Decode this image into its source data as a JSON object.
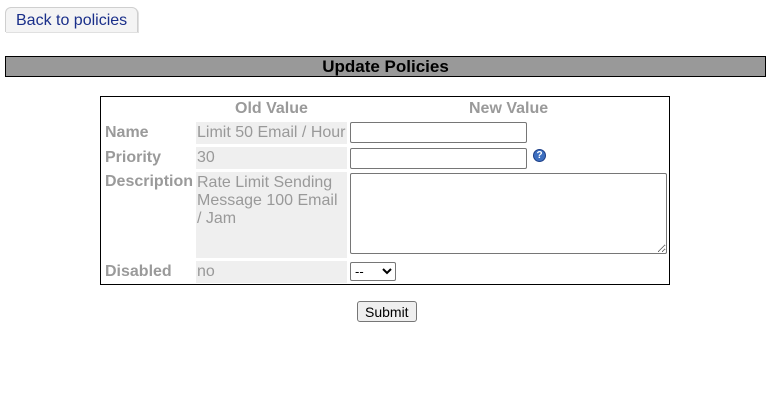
{
  "nav": {
    "back_label": "Back to policies"
  },
  "page": {
    "title": "Update Policies"
  },
  "table": {
    "col_old": "Old Value",
    "col_new": "New Value",
    "rows": [
      {
        "label": "Name",
        "old": "Limit 50 Email / Hour",
        "new_value": ""
      },
      {
        "label": "Priority",
        "old": "30",
        "new_value": ""
      },
      {
        "label": "Description",
        "old": "Rate Limit Sending Message 100 Email / Jam",
        "new_value": ""
      },
      {
        "label": "Disabled",
        "old": "no",
        "new_value": "--"
      }
    ]
  },
  "disabled_options": [
    "--"
  ],
  "submit_label": "Submit",
  "icons": {
    "help": "help-question-icon"
  }
}
